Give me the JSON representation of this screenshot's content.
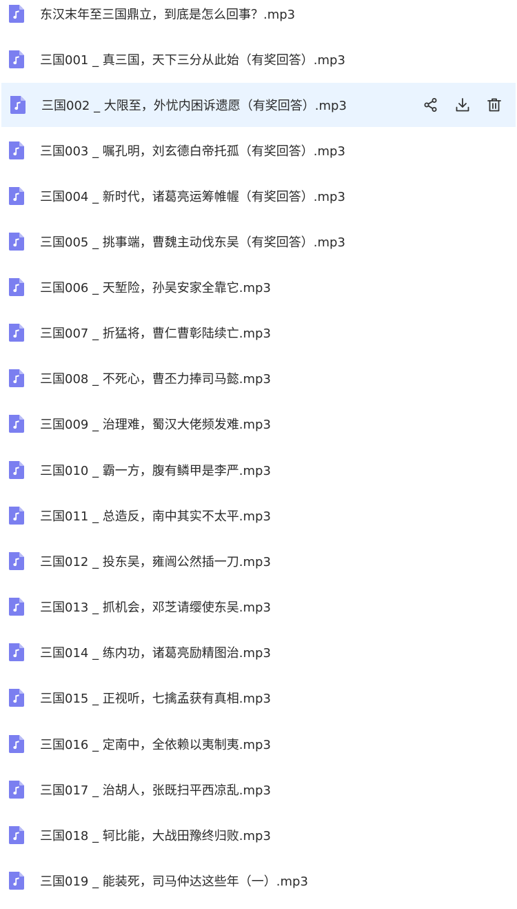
{
  "files": [
    {
      "name": "东汉末年至三国鼎立，到底是怎么回事？.mp3",
      "icon": "audio-file-icon"
    },
    {
      "name": "三国001 _ 真三国，天下三分从此始（有奖回答）.mp3",
      "icon": "audio-file-icon"
    },
    {
      "name": "三国002 _ 大限至，外忧内困诉遗愿（有奖回答）.mp3",
      "icon": "audio-file-icon",
      "selected": true
    },
    {
      "name": "三国003 _ 嘱孔明，刘玄德白帝托孤（有奖回答）.mp3",
      "icon": "audio-file-icon"
    },
    {
      "name": "三国004 _ 新时代，诸葛亮运筹帷幄（有奖回答）.mp3",
      "icon": "audio-file-icon"
    },
    {
      "name": "三国005 _ 挑事端，曹魏主动伐东吴（有奖回答）.mp3",
      "icon": "audio-file-icon"
    },
    {
      "name": "三国006 _ 天堑险，孙吴安家全靠它.mp3",
      "icon": "audio-file-icon"
    },
    {
      "name": "三国007 _ 折猛将，曹仁曹彰陆续亡.mp3",
      "icon": "audio-file-icon"
    },
    {
      "name": "三国008 _ 不死心，曹丕力捧司马懿.mp3",
      "icon": "audio-file-icon"
    },
    {
      "name": "三国009 _ 治理难，蜀汉大佬频发难.mp3",
      "icon": "audio-file-icon"
    },
    {
      "name": "三国010 _ 霸一方，腹有鳞甲是李严.mp3",
      "icon": "audio-file-icon"
    },
    {
      "name": "三国011 _ 总造反，南中其实不太平.mp3",
      "icon": "audio-file-icon"
    },
    {
      "name": "三国012 _ 投东吴，雍闿公然插一刀.mp3",
      "icon": "audio-file-icon"
    },
    {
      "name": "三国013 _ 抓机会，邓芝请缨使东吴.mp3",
      "icon": "audio-file-icon"
    },
    {
      "name": "三国014 _ 练内功，诸葛亮励精图治.mp3",
      "icon": "audio-file-icon"
    },
    {
      "name": "三国015 _ 正视听，七擒孟获有真相.mp3",
      "icon": "audio-file-icon"
    },
    {
      "name": "三国016 _ 定南中，全依赖以夷制夷.mp3",
      "icon": "audio-file-icon"
    },
    {
      "name": "三国017 _ 治胡人，张既扫平西凉乱.mp3",
      "icon": "audio-file-icon"
    },
    {
      "name": "三国018 _ 轲比能，大战田豫终归败.mp3",
      "icon": "audio-file-icon"
    },
    {
      "name": "三国019 _ 能装死，司马仲达这些年（一）.mp3",
      "icon": "audio-file-icon"
    }
  ],
  "row_actions": [
    {
      "icon": "share-icon"
    },
    {
      "icon": "download-icon"
    },
    {
      "icon": "delete-icon"
    }
  ],
  "colors": {
    "file_icon_bg": "#7b7ff0",
    "selected_row_bg": "#eaf4ff",
    "action_icon": "#333333",
    "text": "#2a2a2a"
  }
}
